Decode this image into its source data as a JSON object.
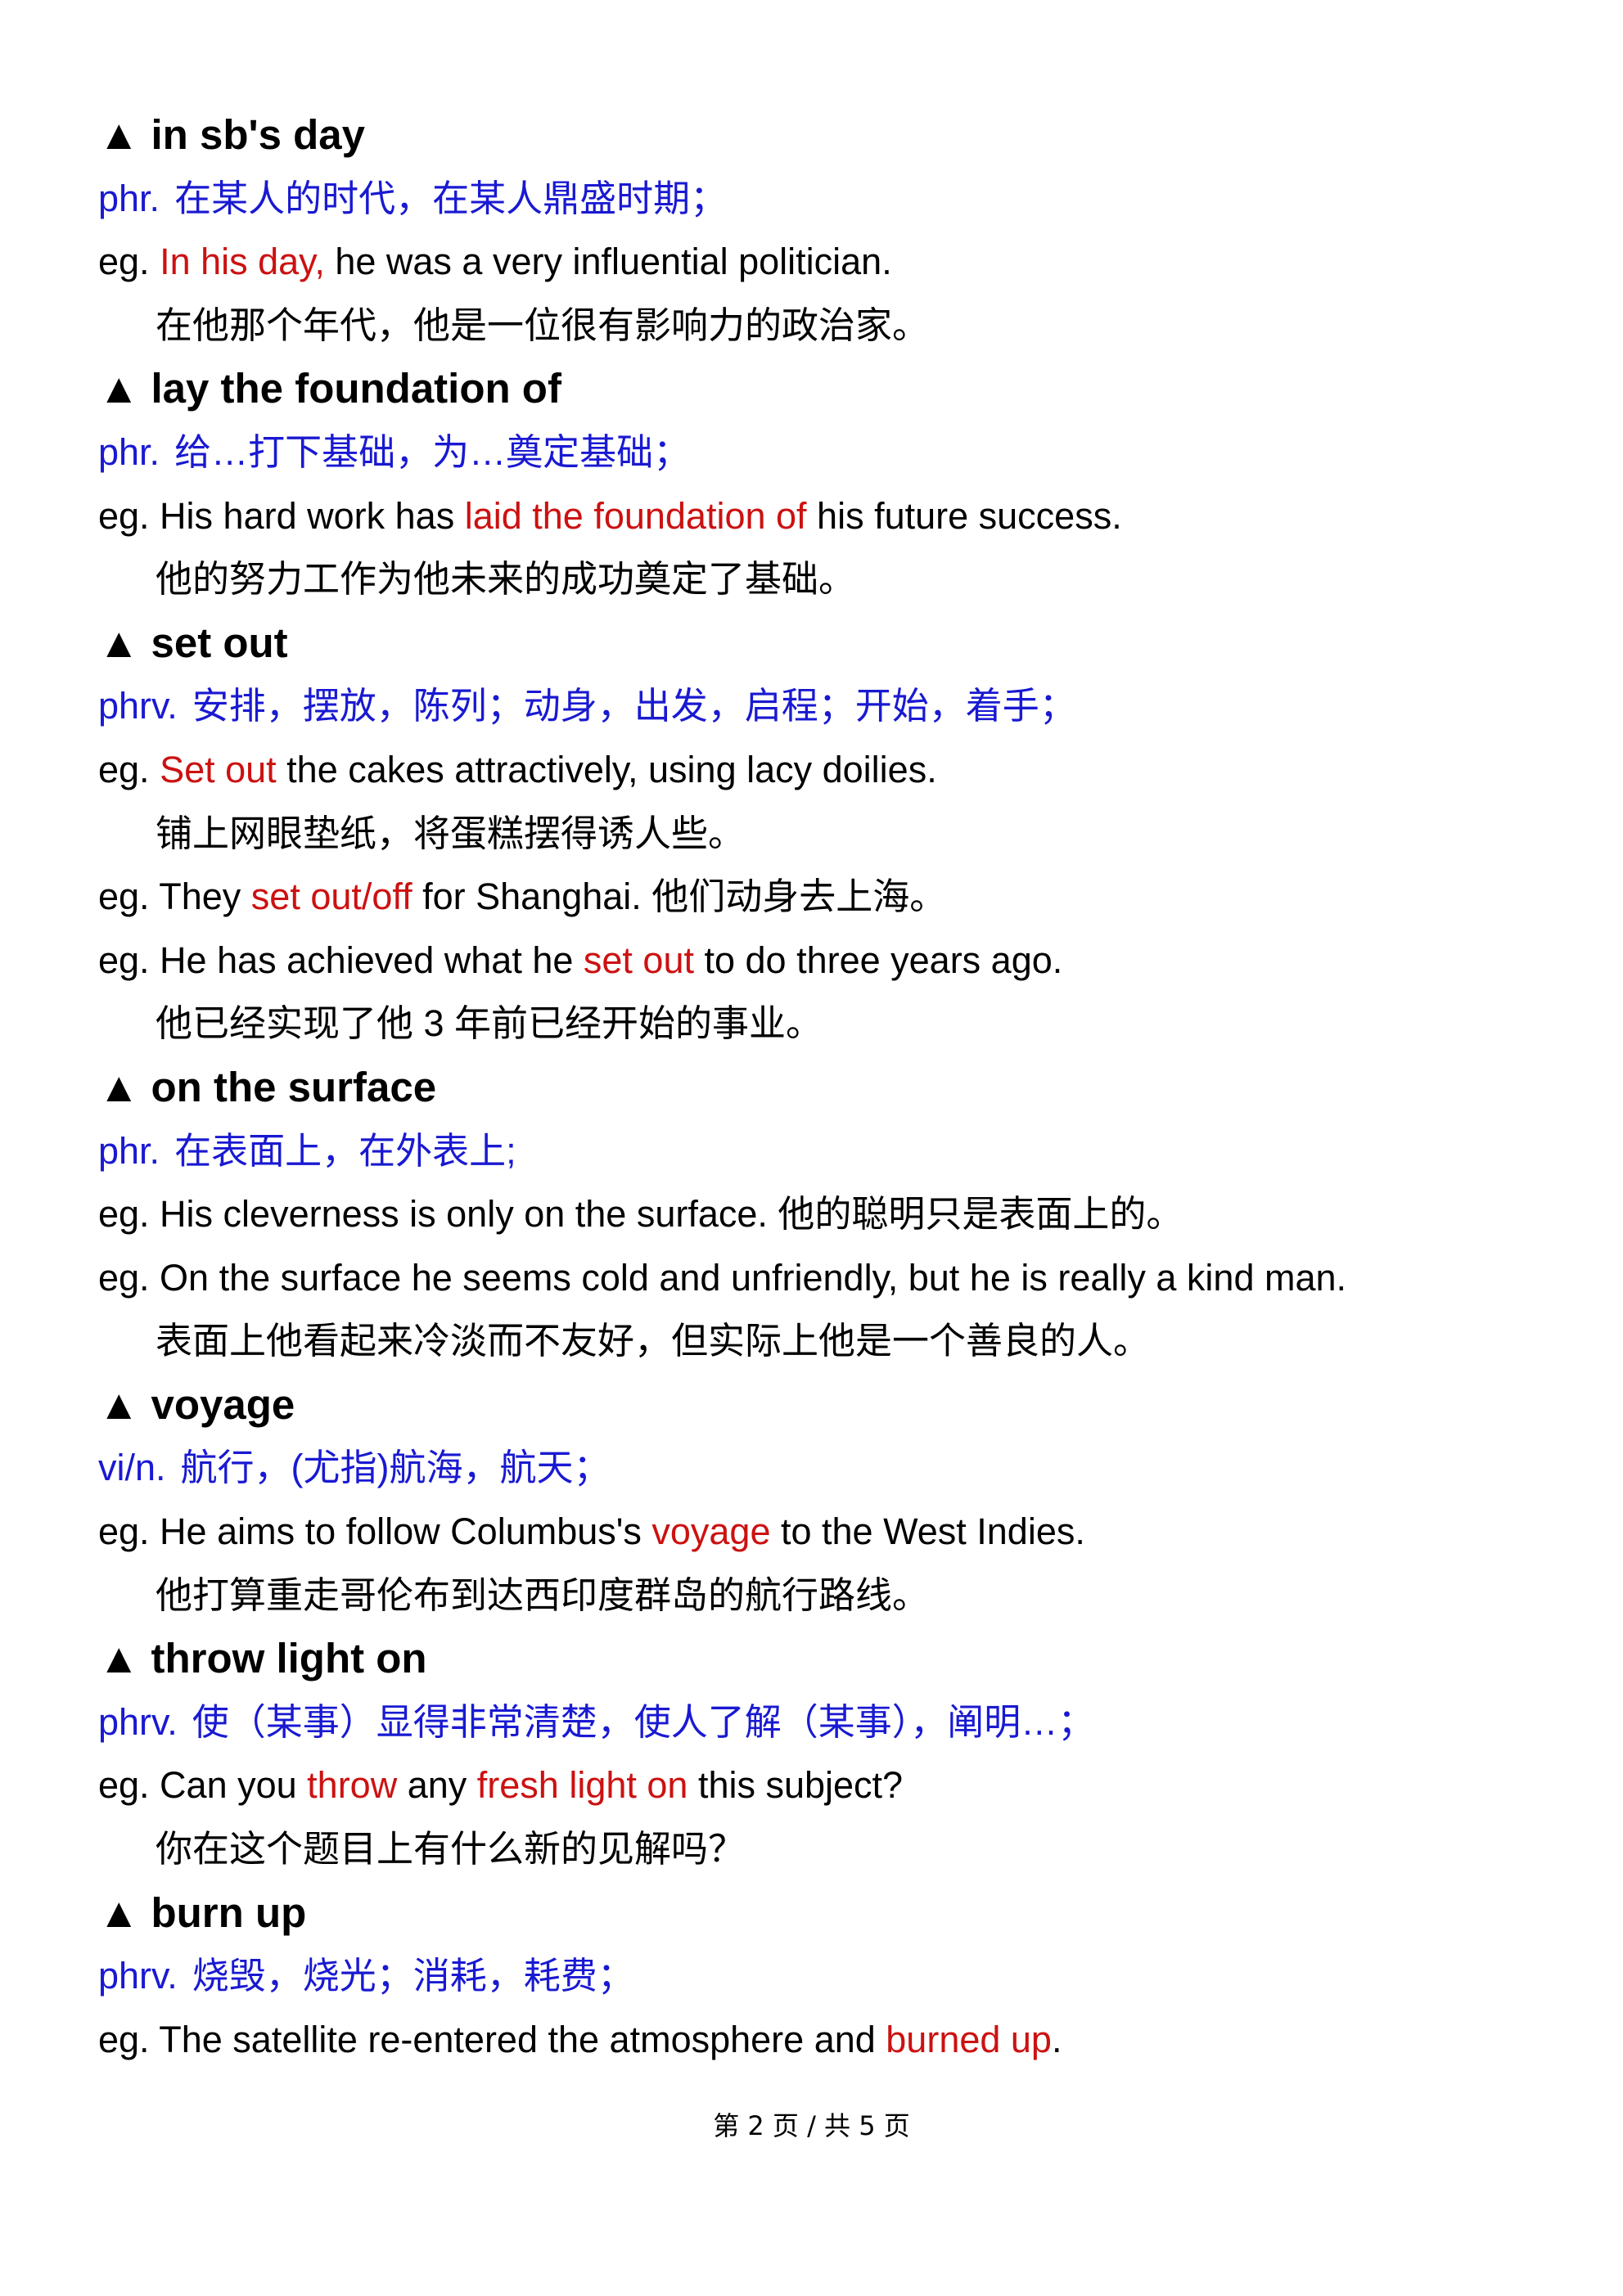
{
  "entries": [
    {
      "term": "in sb's day",
      "def_pos": "phr.",
      "def_text": "在某人的时代，在某人鼎盛时期；",
      "examples": [
        {
          "segments": [
            {
              "t": "eg. "
            },
            {
              "t": "In his day,",
              "hl": true
            },
            {
              "t": " he was a very influential politician."
            }
          ]
        },
        {
          "indent": true,
          "segments": [
            {
              "t": "在他那个年代，他是一位很有影响力的政治家。"
            }
          ]
        }
      ]
    },
    {
      "term": "lay the foundation of",
      "def_pos": "phr.",
      "def_text": "给…打下基础，为…奠定基础；",
      "examples": [
        {
          "segments": [
            {
              "t": "eg. His hard work has "
            },
            {
              "t": "laid the foundation of",
              "hl": true
            },
            {
              "t": " his future success."
            }
          ]
        },
        {
          "indent": true,
          "segments": [
            {
              "t": "他的努力工作为他未来的成功奠定了基础。"
            }
          ]
        }
      ]
    },
    {
      "term": "set out",
      "def_pos": "phrv.",
      "def_text": "安排，摆放，陈列；动身，出发，启程；开始，着手；",
      "examples": [
        {
          "segments": [
            {
              "t": "eg. "
            },
            {
              "t": "Set out",
              "hl": true
            },
            {
              "t": " the cakes attractively, using lacy doilies."
            }
          ]
        },
        {
          "indent": true,
          "segments": [
            {
              "t": "铺上网眼垫纸，将蛋糕摆得诱人些。"
            }
          ]
        },
        {
          "segments": [
            {
              "t": "eg. They "
            },
            {
              "t": "set out/off",
              "hl": true
            },
            {
              "t": " for Shanghai. 他们动身去上海。"
            }
          ]
        },
        {
          "segments": [
            {
              "t": "eg. He has achieved what he "
            },
            {
              "t": "set out",
              "hl": true
            },
            {
              "t": " to do three years ago."
            }
          ]
        },
        {
          "indent": true,
          "segments": [
            {
              "t": "他已经实现了他 3 年前已经开始的事业。"
            }
          ]
        }
      ]
    },
    {
      "term": "on the surface",
      "def_pos": "phr.",
      "def_text": "在表面上，在外表上;",
      "examples": [
        {
          "segments": [
            {
              "t": "eg. His cleverness is only on the surface. 他的聪明只是表面上的。"
            }
          ]
        },
        {
          "segments": [
            {
              "t": "eg. On the surface he seems cold and unfriendly, but he is really a kind man."
            }
          ]
        },
        {
          "indent": true,
          "segments": [
            {
              "t": "表面上他看起来冷淡而不友好，但实际上他是一个善良的人。"
            }
          ]
        }
      ]
    },
    {
      "term": "voyage",
      "def_pos": "vi/n.",
      "def_text": "航行，(尤指)航海，航天；",
      "examples": [
        {
          "segments": [
            {
              "t": "eg. He aims to follow Columbus's "
            },
            {
              "t": "voyage",
              "hl": true
            },
            {
              "t": " to the West Indies."
            }
          ]
        },
        {
          "indent": true,
          "segments": [
            {
              "t": "他打算重走哥伦布到达西印度群岛的航行路线。"
            }
          ]
        }
      ]
    },
    {
      "term": "throw light on",
      "def_pos": "phrv.",
      "def_text": "使（某事）显得非常清楚，使人了解（某事），阐明…；",
      "examples": [
        {
          "segments": [
            {
              "t": "eg. Can you "
            },
            {
              "t": "throw",
              "hl": true
            },
            {
              "t": " any "
            },
            {
              "t": "fresh light on",
              "hl": true
            },
            {
              "t": " this subject?"
            }
          ]
        },
        {
          "indent": true,
          "segments": [
            {
              "t": "你在这个题目上有什么新的见解吗？"
            }
          ]
        }
      ]
    },
    {
      "term": "burn up",
      "def_pos": "phrv.",
      "def_text": "烧毁，烧光；消耗，耗费；",
      "examples": [
        {
          "segments": [
            {
              "t": "eg. The satellite re-entered the atmosphere and "
            },
            {
              "t": "burned up",
              "hl": true
            },
            {
              "t": "."
            }
          ]
        }
      ]
    }
  ],
  "footer": "第 2 页 / 共 5 页"
}
